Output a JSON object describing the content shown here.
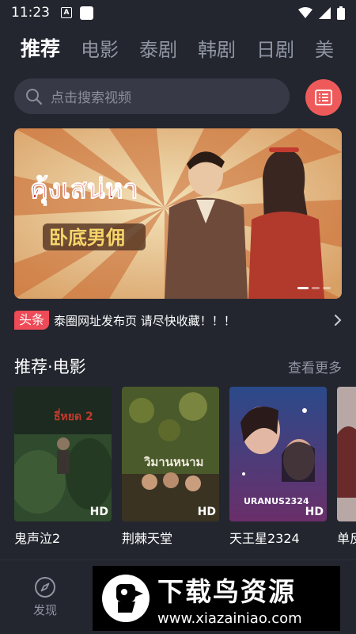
{
  "status_bar": {
    "time": "11:23",
    "notif_letter": "A"
  },
  "tabs": [
    {
      "label": "推荐",
      "active": true
    },
    {
      "label": "电影"
    },
    {
      "label": "泰剧"
    },
    {
      "label": "韩剧"
    },
    {
      "label": "日剧"
    },
    {
      "label": "美"
    }
  ],
  "search": {
    "placeholder": "点击搜索视频"
  },
  "banner": {
    "thai_title": "คุ้งเสน่หา",
    "cn_title": "卧底男佣"
  },
  "news": {
    "badge": "头条",
    "text": "泰圈网址发布页 请尽快收藏！！！"
  },
  "section": {
    "title": "推荐·电影",
    "more": "查看更多"
  },
  "movies": [
    {
      "title": "鬼声泣2",
      "badge": "HD",
      "poster_text": "ธี่หยด 2"
    },
    {
      "title": "荆棘天堂",
      "badge": "HD",
      "poster_text": "วิมานหนาม"
    },
    {
      "title": "天王星2324",
      "badge": "HD",
      "poster_text": "URANUS2324"
    },
    {
      "title": "单反"
    }
  ],
  "bottom_nav": {
    "discover_label": "发现"
  },
  "watermark": {
    "title": "下载鸟资源",
    "url": "www.xiazainiao.com"
  },
  "colors": {
    "accent": "#ee4a57",
    "background": "#23262f",
    "search_bg": "#373a46"
  }
}
